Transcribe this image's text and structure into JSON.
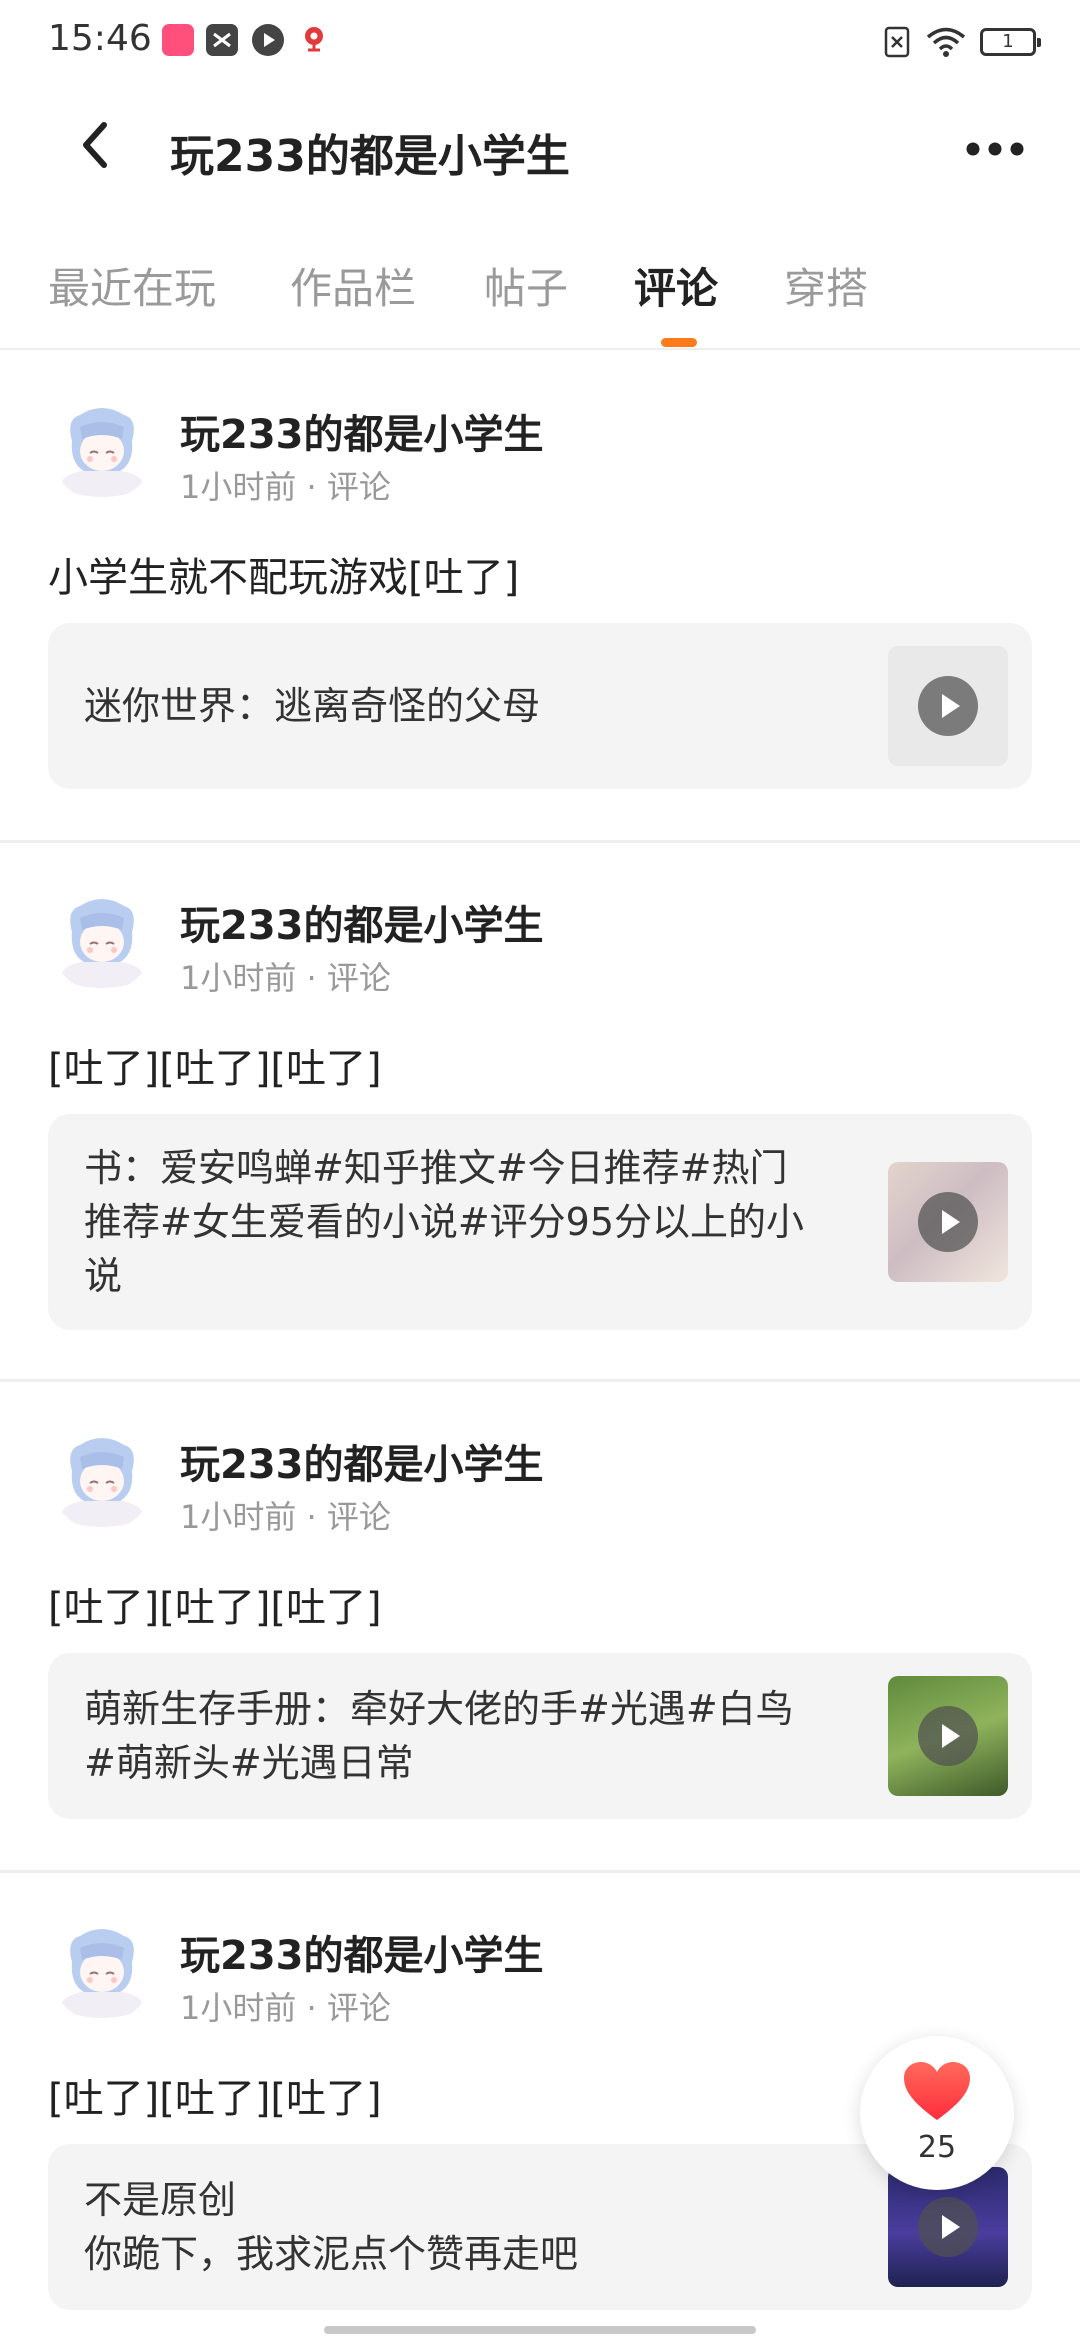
{
  "status_bar": {
    "time": "15:46",
    "apps": [
      {
        "icon": "lofter-app-icon",
        "color": "#ff4f7a"
      },
      {
        "icon": "capcut-app-icon",
        "color": "#444444"
      },
      {
        "icon": "video-app-icon",
        "color": "#444444"
      },
      {
        "icon": "location-app-icon",
        "color": "#e23a3a"
      }
    ],
    "battery_level": "1"
  },
  "header": {
    "title": "玩233的都是小学生",
    "back_icon": "chevron-left-icon",
    "more_icon": "more-horizontal-icon"
  },
  "tabs": [
    {
      "label": "最近在玩",
      "active": false
    },
    {
      "label": "作品栏",
      "active": false
    },
    {
      "label": "帖子",
      "active": false
    },
    {
      "label": "评论",
      "active": true
    },
    {
      "label": "穿搭",
      "active": false
    }
  ],
  "accent_color": "#ff7a1a",
  "feed": [
    {
      "author": "玩233的都是小学生",
      "time": "1小时前",
      "type": "评论",
      "content": "小学生就不配玩游戏[吐了]",
      "quote": "迷你世界：逃离奇怪的父母",
      "thumb": "placeholder-thumbnail"
    },
    {
      "author": "玩233的都是小学生",
      "time": "1小时前",
      "type": "评论",
      "content": "[吐了][吐了][吐了]",
      "quote": "书：爱安鸣蝉#知乎推文#今日推荐#热门\n推荐#女生爱看的小说#评分95分以上的小\n说",
      "thumb": "flowers-thumbnail"
    },
    {
      "author": "玩233的都是小学生",
      "time": "1小时前",
      "type": "评论",
      "content": "[吐了][吐了][吐了]",
      "quote": "萌新生存手册：牵好大佬的手#光遇#白鸟\n#萌新头#光遇日常",
      "thumb": "game-green-thumbnail"
    },
    {
      "author": "玩233的都是小学生",
      "time": "1小时前",
      "type": "评论",
      "content": "[吐了][吐了][吐了]",
      "quote": "不是原创\n你跪下，我求泥点个赞再走吧",
      "thumb": "game-purple-thumbnail"
    }
  ],
  "like_fab": {
    "count": "25",
    "icon": "heart-icon",
    "color": "#ff3b3b"
  }
}
